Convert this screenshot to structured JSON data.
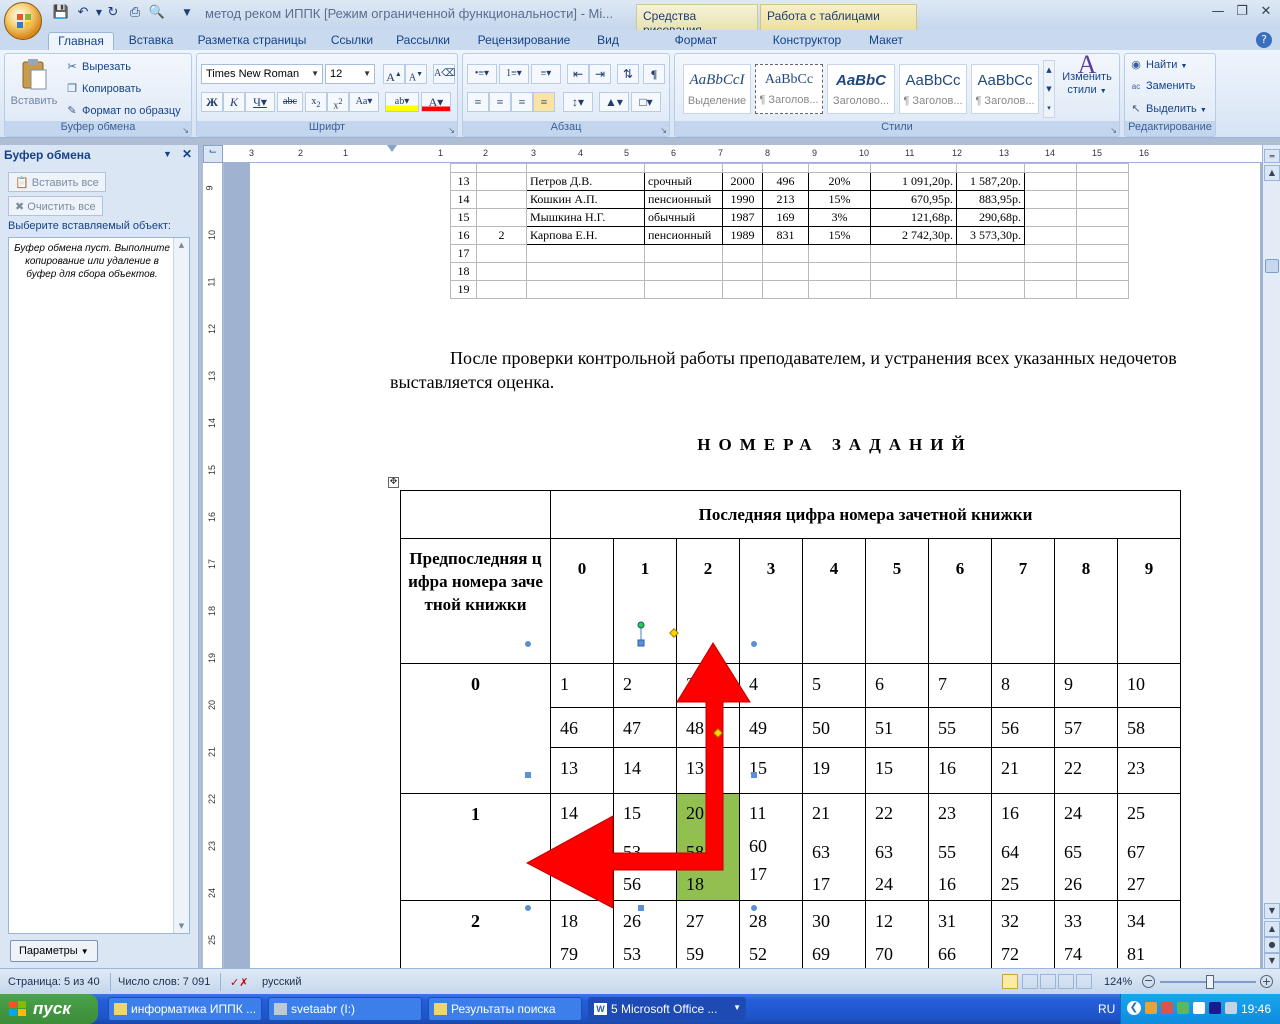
{
  "window": {
    "title": "метод реком ИППК [Режим ограниченной функциональности] - Mi...",
    "context_tabs": [
      "Средства рисования",
      "Работа с таблицами"
    ]
  },
  "tabs": [
    "Главная",
    "Вставка",
    "Разметка страницы",
    "Ссылки",
    "Рассылки",
    "Рецензирование",
    "Вид",
    "Формат",
    "Конструктор",
    "Макет"
  ],
  "ribbon": {
    "clipboard": {
      "paste": "Вставить",
      "cut": "Вырезать",
      "copy": "Копировать",
      "format_painter": "Формат по образцу",
      "label": "Буфер обмена"
    },
    "font": {
      "name": "Times New Roman",
      "size": "12",
      "label": "Шрифт"
    },
    "paragraph": {
      "label": "Абзац"
    },
    "styles": {
      "items": [
        {
          "sample": "AaBbCcI",
          "name": "Выделение"
        },
        {
          "sample": "AaBbCc",
          "name": "¶ Заголов..."
        },
        {
          "sample": "AaBbC",
          "name": "Заголово..."
        },
        {
          "sample": "AaBbCc",
          "name": "¶ Заголов..."
        },
        {
          "sample": "AaBbCc",
          "name": "¶ Заголов..."
        }
      ],
      "change_styles_1": "Изменить",
      "change_styles_2": "стили",
      "label": "Стили"
    },
    "editing": {
      "find": "Найти",
      "replace": "Заменить",
      "select": "Выделить",
      "label": "Редактирование"
    }
  },
  "clipboard_pane": {
    "title": "Буфер обмена",
    "paste_all": "Вставить все",
    "clear_all": "Очистить все",
    "select_label": "Выберите вставляемый объект:",
    "empty_text": "Буфер обмена пуст. Выполните копирование или удаление в буфер для сбора объектов.",
    "params": "Параметры"
  },
  "ruler": {
    "h_numbers": [
      "3",
      "2",
      "1",
      "1",
      "2",
      "3",
      "4",
      "5",
      "6",
      "7",
      "8",
      "9",
      "10",
      "11",
      "12",
      "13",
      "14",
      "15",
      "16"
    ],
    "v_numbers": [
      "9",
      "10",
      "11",
      "12",
      "13",
      "14",
      "15",
      "16",
      "17",
      "18",
      "19",
      "20",
      "21",
      "22",
      "23",
      "24",
      "25"
    ]
  },
  "spreadsheet": {
    "rows": [
      {
        "num": "13",
        "group": "",
        "name": "Петров Д.В.",
        "type": "срочный",
        "year": "2000",
        "n": "496",
        "pct": "20%",
        "sum1": "1 091,20р.",
        "sum2": "1 587,20р."
      },
      {
        "num": "14",
        "group": "",
        "name": "Кошкин А.П.",
        "type": "пенсионный",
        "year": "1990",
        "n": "213",
        "pct": "15%",
        "sum1": "670,95р.",
        "sum2": "883,95р."
      },
      {
        "num": "15",
        "group": "",
        "name": "Мышкина Н.Г.",
        "type": "обычный",
        "year": "1987",
        "n": "169",
        "pct": "3%",
        "sum1": "121,68р.",
        "sum2": "290,68р."
      },
      {
        "num": "16",
        "group": "2",
        "name": "Карпова Е.Н.",
        "type": "пенсионный",
        "year": "1989",
        "n": "831",
        "pct": "15%",
        "sum1": "2 742,30р.",
        "sum2": "3 573,30р."
      }
    ],
    "empty_rows": [
      "17",
      "18",
      "19"
    ]
  },
  "document": {
    "paragraph": "После проверки контрольной работы преподавателем, и устранения всех указанных недочетов выставляется оценка.",
    "heading": "НОМЕРА ЗАДАНИЙ",
    "table": {
      "header_main": "Последняя цифра номера зачетной книжки",
      "header_side": "Предпоследняя цифра номера зачетной книжки",
      "digits": [
        "0",
        "1",
        "2",
        "3",
        "4",
        "5",
        "6",
        "7",
        "8",
        "9"
      ],
      "rows": [
        {
          "label": "0",
          "lines": [
            [
              "1",
              "2",
              "3",
              "4",
              "5",
              "6",
              "7",
              "8",
              "9",
              "10"
            ],
            [
              "46",
              "47",
              "48",
              "49",
              "50",
              "51",
              "55",
              "56",
              "57",
              "58"
            ],
            [
              "13",
              "14",
              "13",
              "15",
              "19",
              "15",
              "16",
              "21",
              "22",
              "23"
            ]
          ]
        },
        {
          "label": "1",
          "cells": [
            [
              "14",
              "",
              ""
            ],
            [
              "15",
              "53",
              "56"
            ],
            [
              "20",
              "58",
              "18"
            ],
            [
              "11",
              "60",
              "17"
            ],
            [
              "21",
              "63",
              "17"
            ],
            [
              "22",
              "63",
              "24"
            ],
            [
              "23",
              "55",
              "16"
            ],
            [
              "16",
              "64",
              "25"
            ],
            [
              "24",
              "65",
              "26"
            ],
            [
              "25",
              "67",
              "27"
            ]
          ]
        },
        {
          "label": "2",
          "cells": [
            [
              "18",
              "79"
            ],
            [
              "26",
              "53"
            ],
            [
              "27",
              "59"
            ],
            [
              "28",
              "52"
            ],
            [
              "30",
              "69"
            ],
            [
              "12",
              "70"
            ],
            [
              "31",
              "66"
            ],
            [
              "32",
              "72"
            ],
            [
              "33",
              "74"
            ],
            [
              "34",
              "81"
            ]
          ]
        }
      ]
    }
  },
  "status": {
    "page": "Страница: 5 из 40",
    "words": "Число слов: 7 091",
    "lang": "русский",
    "zoom": "124%"
  },
  "taskbar": {
    "start": "пуск",
    "items": [
      "информатика ИППК ...",
      "svetaabr (I:)",
      "Результаты поиска",
      "5 Microsoft Office ..."
    ],
    "lang": "RU",
    "time": "19:46"
  },
  "colors": {
    "highlight_cell": "#92c050",
    "arrow": "#ff0000"
  }
}
